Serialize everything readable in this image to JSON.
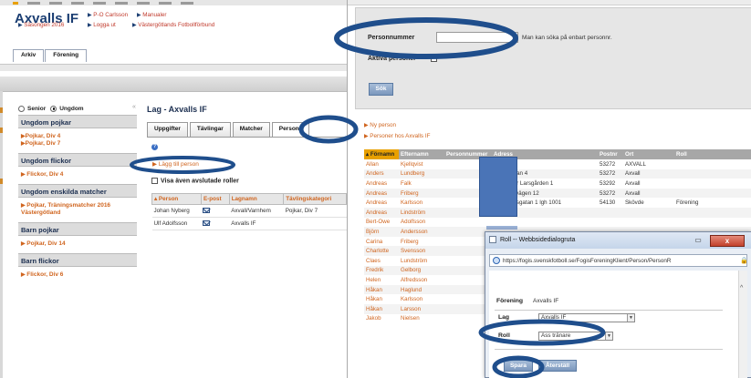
{
  "left": {
    "club_name": "Axvalls IF",
    "header_links": {
      "user": "P-O Carlsson",
      "manuals": "Manualer",
      "season": "Säsongen 2016",
      "logout": "Logga ut",
      "federation": "Västergötlands Fotbollförbund"
    },
    "top_tabs": [
      "Arkiv",
      "Förening"
    ],
    "sidebar": {
      "radio_senior": "Senior",
      "radio_youth": "Ungdom",
      "collapse": "«",
      "sections": [
        {
          "title": "Ungdom pojkar",
          "links": [
            "Pojkar, Div 4",
            "Pojkar, Div 7"
          ]
        },
        {
          "title": "Ungdom flickor",
          "links": [
            "Flickor, Div 4"
          ]
        },
        {
          "title": "Ungdom enskilda matcher",
          "links": [
            "Pojkar, Träningsmatcher 2016 Västergötland"
          ]
        },
        {
          "title": "Barn pojkar",
          "links": [
            "Pojkar, Div 14"
          ]
        },
        {
          "title": "Barn flickor",
          "links": [
            "Flickor, Div 6"
          ]
        }
      ]
    },
    "main": {
      "title": "Lag - Axvalls IF",
      "tabs": [
        "Uppgifter",
        "Tävlingar",
        "Matcher",
        "Persone"
      ],
      "add_person": "Lägg till person",
      "show_ended": "Visa även avslutade roller",
      "table": {
        "headers": [
          "Person",
          "E-post",
          "Lagnamn",
          "Tävlingskategori"
        ],
        "rows": [
          {
            "person": "Johan Nyberg",
            "team": "Axvall/Varnhem",
            "category": "Pojkar, Div 7"
          },
          {
            "person": "Ulf Adolfsson",
            "team": "Axvalls IF",
            "category": ""
          }
        ]
      }
    }
  },
  "right": {
    "search": {
      "pn_label": "Personnummer",
      "pn_value": "",
      "pn_hint": "Man kan söka på enbart personnr.",
      "active_label": "Aktiva personer",
      "search_button": "Sök"
    },
    "links": {
      "new_person": "Ny person",
      "persons_at": "Personer hos Axvalls IF"
    },
    "table": {
      "headers": [
        "Förnamn",
        "Efternamn",
        "Personnummer",
        "Adress",
        "Postnr",
        "Ort",
        "Roll"
      ],
      "rows": [
        [
          "Allan",
          "Kjellqvist",
          "",
          "",
          "53272",
          "AXVALL",
          ""
        ],
        [
          "Anders",
          "Lundberg",
          "",
          "Husargatan 4",
          "53272",
          "Axvall",
          ""
        ],
        [
          "Andreas",
          "Falk",
          "",
          "Skärv Per Larsgården 1",
          "53292",
          "Axvall",
          ""
        ],
        [
          "Andreas",
          "Friberg",
          "",
          "Tranumsvägen 12",
          "53272",
          "Axvall",
          ""
        ],
        [
          "Andreas",
          "Karlsson",
          "",
          "Trädgårdsgatan 1 lgh 1001",
          "54130",
          "Skövde",
          "Förening"
        ],
        [
          "Andreas",
          "Lindström",
          "",
          "",
          "",
          "",
          ""
        ],
        [
          "Bert-Owe",
          "Adolfsson",
          "",
          "",
          "",
          "",
          ""
        ],
        [
          "Björn",
          "Andersson",
          "",
          "",
          "",
          "",
          ""
        ],
        [
          "Carina",
          "Friberg",
          "",
          "",
          "",
          "",
          ""
        ],
        [
          "Charlotte",
          "Svensson",
          "",
          "",
          "",
          "",
          ""
        ],
        [
          "Claes",
          "Lundström",
          "",
          "",
          "",
          "",
          ""
        ],
        [
          "Fredrik",
          "Gelborg",
          "",
          "",
          "",
          "",
          ""
        ],
        [
          "Helen",
          "Alfredsson",
          "",
          "",
          "",
          "",
          ""
        ],
        [
          "Håkan",
          "Haglund",
          "",
          "",
          "",
          "",
          ""
        ],
        [
          "Håkan",
          "Karlsson",
          "",
          "",
          "",
          "",
          ""
        ],
        [
          "Håkan",
          "Larsson",
          "",
          "",
          "",
          "",
          ""
        ],
        [
          "Jakob",
          "Nielsen",
          "",
          "",
          "",
          "",
          ""
        ]
      ]
    },
    "dialog": {
      "title": "Roll -- Webbsidedialogruta",
      "minimize": "▭",
      "close": "x",
      "url": "https://fogis.svenskfotboll.se/FogisForeningKlient/Person/PersonR",
      "forening_label": "Förening",
      "forening_value": "Axvalls IF",
      "lag_label": "Lag",
      "lag_value": "Axvalls IF",
      "roll_label": "Roll",
      "roll_value": "Ass tränare",
      "save_button": "Spara",
      "reset_button": "Återställ"
    }
  },
  "colors": {
    "link_orange": "#d0651f",
    "title_navy": "#1c3f73",
    "highlight_ellipse": "#1f4e8c",
    "header_orange": "#e8a000"
  }
}
